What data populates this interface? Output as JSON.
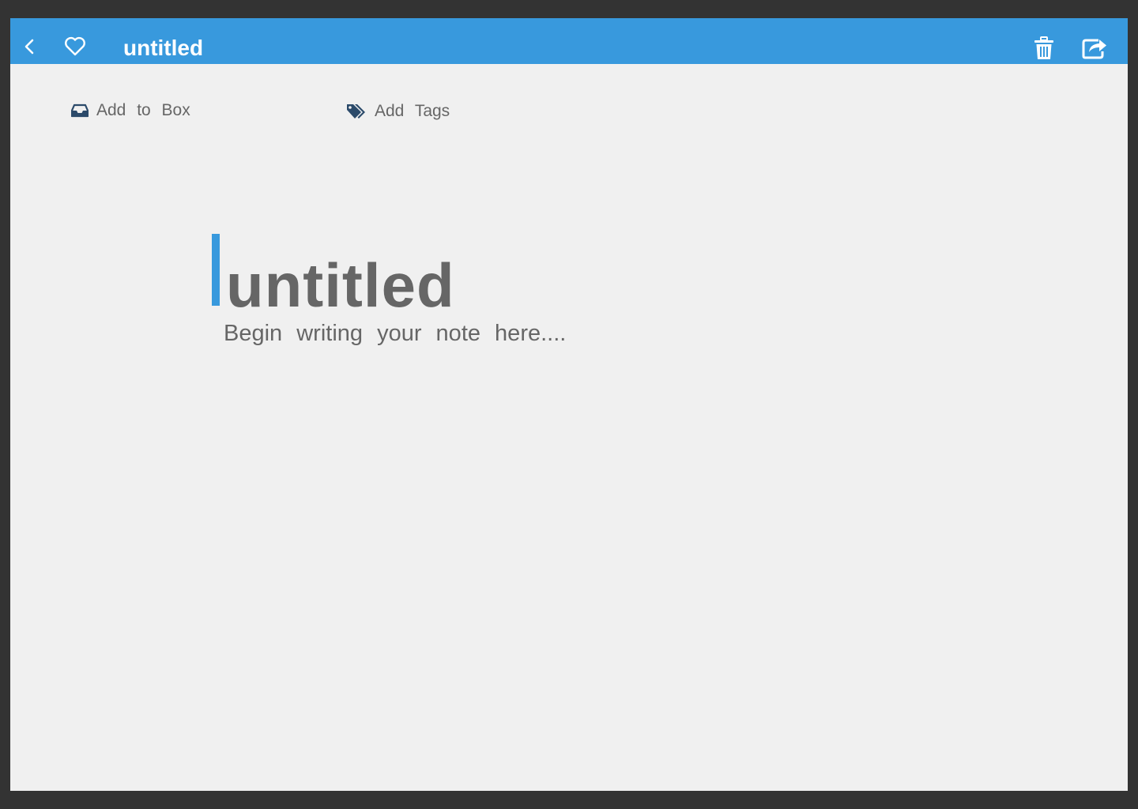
{
  "colors": {
    "accent": "#3899dd",
    "frame": "#333333",
    "canvas": "#f0f0f0",
    "text": "#666666",
    "icon_dark": "#2b4a6a"
  },
  "topbar": {
    "title": "untitled",
    "icons": {
      "back": "chevron-left-icon",
      "favorite": "heart-outline-icon",
      "delete": "trash-icon",
      "share": "share-icon"
    }
  },
  "meta": {
    "add_to_box": {
      "label": "Add to Box",
      "icon": "inbox-tray-icon"
    },
    "add_tags": {
      "label": "Add Tags",
      "icon": "tags-icon"
    }
  },
  "note": {
    "title": "untitled",
    "body_placeholder": "Begin writing your note here...."
  }
}
